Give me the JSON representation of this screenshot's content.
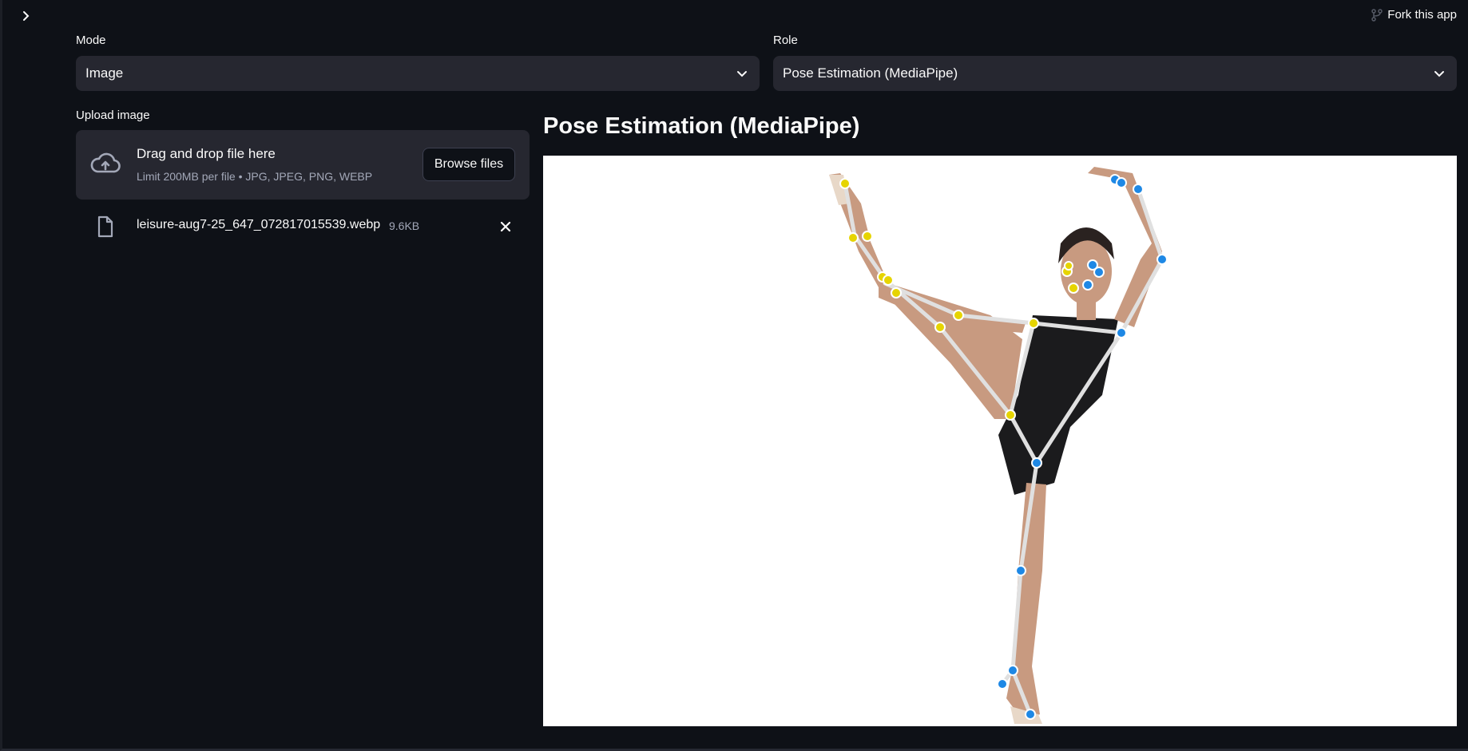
{
  "header": {
    "fork_label": "Fork this app"
  },
  "mode": {
    "label": "Mode",
    "value": "Image"
  },
  "role": {
    "label": "Role",
    "value": "Pose Estimation (MediaPipe)"
  },
  "upload": {
    "label": "Upload image",
    "drop_title": "Drag and drop file here",
    "drop_hint": "Limit 200MB per file • JPG, JPEG, PNG, WEBP",
    "browse_label": "Browse files",
    "file": {
      "name": "leisure-aug7-25_647_072817015539.webp",
      "size": "9.6KB"
    }
  },
  "result": {
    "title": "Pose Estimation (MediaPipe)"
  },
  "colors": {
    "background": "#0e1117",
    "widget": "#262730",
    "left_keypoint": "#e6d400",
    "right_keypoint": "#1e88e5",
    "skeleton": "#e0e0e0"
  }
}
